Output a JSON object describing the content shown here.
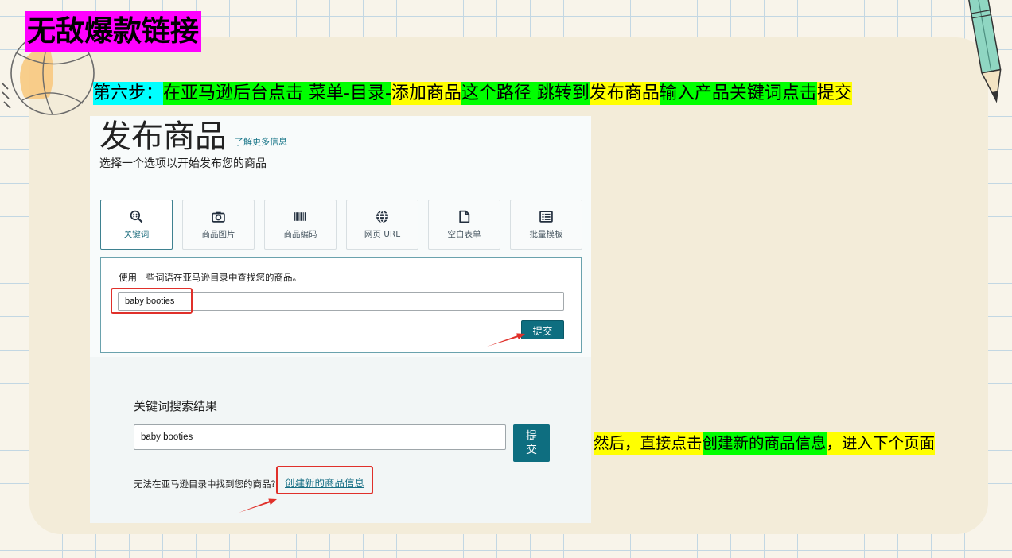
{
  "slide": {
    "title": "无敌爆款链接",
    "title_color": "#ff00ff",
    "step_segments": [
      {
        "text": "第六步：",
        "color": "#00ffff"
      },
      {
        "text": "在亚马逊后台点击 菜单-目录-",
        "color": "#00ff00"
      },
      {
        "text": "添加商品",
        "color": "#ffff00"
      },
      {
        "text": "这个路径 跳转到",
        "color": "#00ff00"
      },
      {
        "text": "发布商品",
        "color": "#ffff00"
      },
      {
        "text": "输入产品关键词点击",
        "color": "#00ff00"
      },
      {
        "text": "提交",
        "color": "#ffff00"
      }
    ],
    "note_segments": [
      {
        "text": "然后，直接点击",
        "color": "#ffff00"
      },
      {
        "text": "创建新的商品信息",
        "color": "#00ff00"
      },
      {
        "text": "，进入下个页面",
        "color": "#ffff00"
      }
    ]
  },
  "publish_page": {
    "heading": "发布商品",
    "learn_more": "了解更多信息",
    "subheading": "选择一个选项以开始发布您的商品",
    "tabs": [
      {
        "label": "关键词",
        "icon": "keyword-search-icon",
        "selected": true
      },
      {
        "label": "商品图片",
        "icon": "camera-icon",
        "selected": false
      },
      {
        "label": "商品编码",
        "icon": "barcode-icon",
        "selected": false
      },
      {
        "label": "网页 URL",
        "icon": "globe-icon",
        "selected": false
      },
      {
        "label": "空白表单",
        "icon": "document-icon",
        "selected": false
      },
      {
        "label": "批量模板",
        "icon": "spreadsheet-icon",
        "selected": false
      }
    ],
    "keyword_panel": {
      "instruction": "使用一些词语在亚马逊目录中查找您的商品。",
      "input_value": "baby booties",
      "submit_label": "提交"
    }
  },
  "search_results": {
    "heading": "关键词搜索结果",
    "input_value": "baby booties",
    "submit_label": "提交",
    "not_found_text": "无法在亚马逊目录中找到您的商品?",
    "create_listing_link": "创建新的商品信息"
  },
  "colors": {
    "amazon_teal": "#0e6e80",
    "annotation_red": "#e0302a"
  }
}
